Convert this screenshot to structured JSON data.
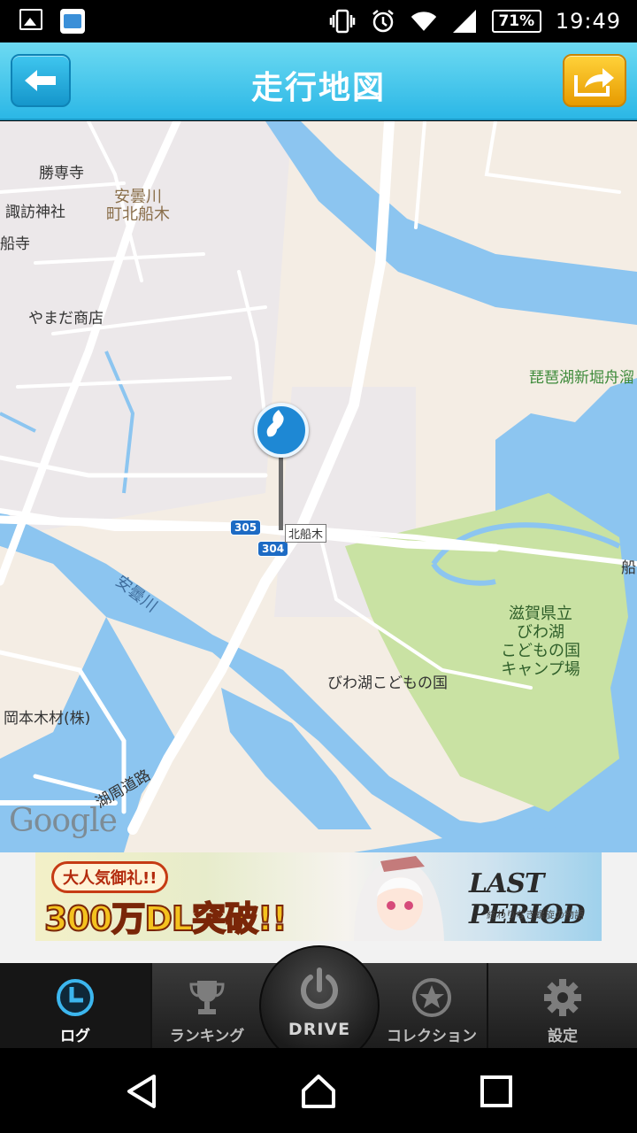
{
  "status_bar": {
    "battery": "71%",
    "time": "19:49",
    "icons": [
      "image-icon",
      "app-notification-icon",
      "vibrate-icon",
      "alarm-icon",
      "wifi-icon",
      "signal-icon",
      "battery-icon"
    ]
  },
  "header": {
    "title": "走行地図",
    "back_icon": "arrow-left-icon",
    "share_icon": "share-arrow-icon",
    "colors": {
      "bar": "#2bb7e6",
      "back_button": "#1596cb",
      "share_button": "#f0b010"
    }
  },
  "map": {
    "labels": {
      "shosenji": "勝専寺",
      "suwa_shrine": "諏訪神社",
      "funadera": "船寺",
      "yamada_shop": "やまだ商店",
      "town1": "安曇川",
      "town2": "町北船木",
      "harbor": "琵琶湖新堀舟溜",
      "river": "安曇川",
      "station": "北船木",
      "park1": "滋賀県立",
      "park2": "びわ湖",
      "park3": "こどもの国",
      "park4": "キャンプ場",
      "kodomo": "びわ湖こどもの国",
      "okamoto": "岡本木材(株)",
      "koshu": "湖周道路",
      "fune": "船",
      "google": "Google"
    },
    "route_numbers": {
      "r305": "305",
      "r304": "304"
    },
    "colors": {
      "land": "#f4ede4",
      "water": "#8cc5f0",
      "park": "#c9e2a3",
      "road": "#ffffff",
      "pin": "#1e88d4"
    }
  },
  "ad": {
    "pill": "大人気御礼!!",
    "headline": "300万DL突破!!",
    "logo": "LAST PERIOD",
    "subtitle": "終わりなき螺旋の物語"
  },
  "tabs": [
    {
      "label": "ログ",
      "icon": "clock-icon",
      "active": true
    },
    {
      "label": "ランキング",
      "icon": "trophy-icon",
      "active": false
    },
    {
      "label": "DRIVE",
      "icon": "power-icon",
      "active": false
    },
    {
      "label": "コレクション",
      "icon": "star-medal-icon",
      "active": false
    },
    {
      "label": "設定",
      "icon": "gear-icon",
      "active": false
    }
  ]
}
